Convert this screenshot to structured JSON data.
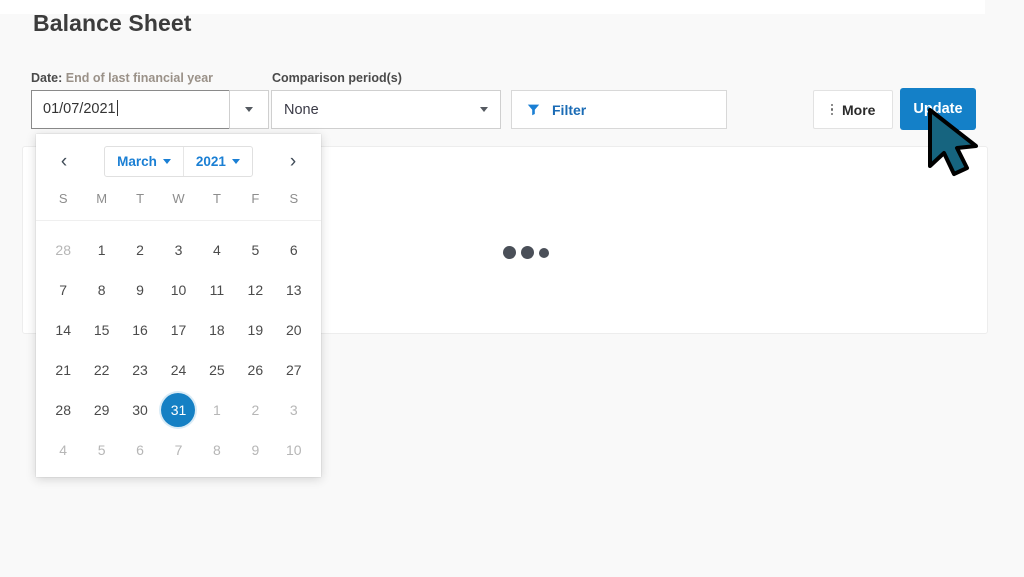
{
  "page": {
    "title": "Balance Sheet"
  },
  "toolbar": {
    "date_field": {
      "label_prefix": "Date:",
      "label_value": "End of last financial year",
      "value": "01/07/2021",
      "toggle_icon": "chevron-down-icon"
    },
    "comparison_field": {
      "label": "Comparison period(s)",
      "value": "None",
      "options": [
        "None"
      ]
    },
    "filter_button": {
      "label": "Filter",
      "icon": "filter-funnel-icon"
    },
    "more_button": {
      "label": "More",
      "icon": "vertical-dots-icon"
    },
    "update_button": {
      "label": "Update"
    }
  },
  "content": {
    "loading_indicator": "three-dots-loading"
  },
  "calendar": {
    "prev_label": "‹",
    "next_label": "›",
    "month": "March",
    "year": "2021",
    "weekdays": [
      "S",
      "M",
      "T",
      "W",
      "T",
      "F",
      "S"
    ],
    "selected_day": "31",
    "weeks": [
      [
        {
          "d": "28",
          "muted": true
        },
        {
          "d": "1"
        },
        {
          "d": "2"
        },
        {
          "d": "3"
        },
        {
          "d": "4"
        },
        {
          "d": "5"
        },
        {
          "d": "6"
        }
      ],
      [
        {
          "d": "7"
        },
        {
          "d": "8"
        },
        {
          "d": "9"
        },
        {
          "d": "10"
        },
        {
          "d": "11"
        },
        {
          "d": "12"
        },
        {
          "d": "13"
        }
      ],
      [
        {
          "d": "14"
        },
        {
          "d": "15"
        },
        {
          "d": "16"
        },
        {
          "d": "17"
        },
        {
          "d": "18"
        },
        {
          "d": "19"
        },
        {
          "d": "20"
        }
      ],
      [
        {
          "d": "21"
        },
        {
          "d": "22"
        },
        {
          "d": "23"
        },
        {
          "d": "24"
        },
        {
          "d": "25"
        },
        {
          "d": "26"
        },
        {
          "d": "27"
        }
      ],
      [
        {
          "d": "28"
        },
        {
          "d": "29"
        },
        {
          "d": "30"
        },
        {
          "d": "31",
          "selected": true
        },
        {
          "d": "1",
          "muted": true
        },
        {
          "d": "2",
          "muted": true
        },
        {
          "d": "3",
          "muted": true
        }
      ],
      [
        {
          "d": "4",
          "muted": true
        },
        {
          "d": "5",
          "muted": true
        },
        {
          "d": "6",
          "muted": true
        },
        {
          "d": "7",
          "muted": true
        },
        {
          "d": "8",
          "muted": true
        },
        {
          "d": "9",
          "muted": true
        },
        {
          "d": "10",
          "muted": true
        }
      ]
    ]
  },
  "colors": {
    "accent_blue": "#1480c8",
    "link_blue": "#1a7fd4",
    "selected_day_bg": "#1580c4",
    "cursor_fill": "#16647f",
    "page_bg": "#f9f9f9"
  }
}
